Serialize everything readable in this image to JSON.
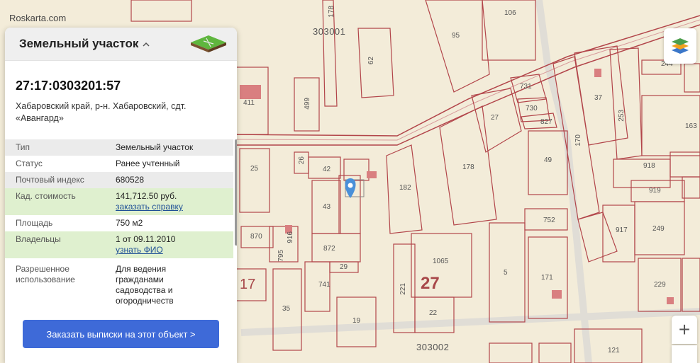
{
  "watermark": "Roskarta.com",
  "panel": {
    "title": "Земельный участок",
    "cadastral_number": "27:17:0303201:57",
    "address": "Хабаровский край, р-н. Хабаровский, сдт. «Авангард»",
    "properties": [
      {
        "key": "Тип",
        "value": "Земельный участок",
        "style": "gray"
      },
      {
        "key": "Статус",
        "value": "Ранее учтенный",
        "style": "white"
      },
      {
        "key": "Почтовый индекс",
        "value": "680528",
        "style": "gray"
      },
      {
        "key": "Кад. стоимость",
        "value": "141,712.50 руб.",
        "link": "заказать справку",
        "style": "green"
      },
      {
        "key": "Площадь",
        "value": "750 м2",
        "style": "white"
      },
      {
        "key": "Владельцы",
        "value": "1 от 09.11.2010",
        "link": "узнать ФИО",
        "style": "green"
      },
      {
        "key": "Разрешенное использование",
        "value": "Для ведения гражданами садоводства и огородничеств",
        "style": "white"
      }
    ],
    "order_button": "Заказать выписки на этот объект >"
  },
  "map": {
    "zoom_in": "+",
    "quarter_labels": [
      "303001",
      "303002"
    ],
    "big_labels": [
      "27",
      "17"
    ],
    "parcel_labels": [
      "178",
      "106",
      "95",
      "62",
      "499",
      "411",
      "244",
      "731",
      "730",
      "827",
      "27",
      "37",
      "253",
      "163",
      "170",
      "49",
      "918",
      "919",
      "178",
      "182",
      "42",
      "26",
      "25",
      "43",
      "870",
      "916",
      "795",
      "872",
      "29",
      "741",
      "35",
      "19",
      "221",
      "1065",
      "22",
      "5",
      "171",
      "229",
      "752",
      "917",
      "249",
      "121"
    ]
  },
  "colors": {
    "map_background": "#f3ecd9",
    "parcel_border": "#b2454a",
    "button": "#3e6ad8",
    "link": "#1e4f96"
  }
}
